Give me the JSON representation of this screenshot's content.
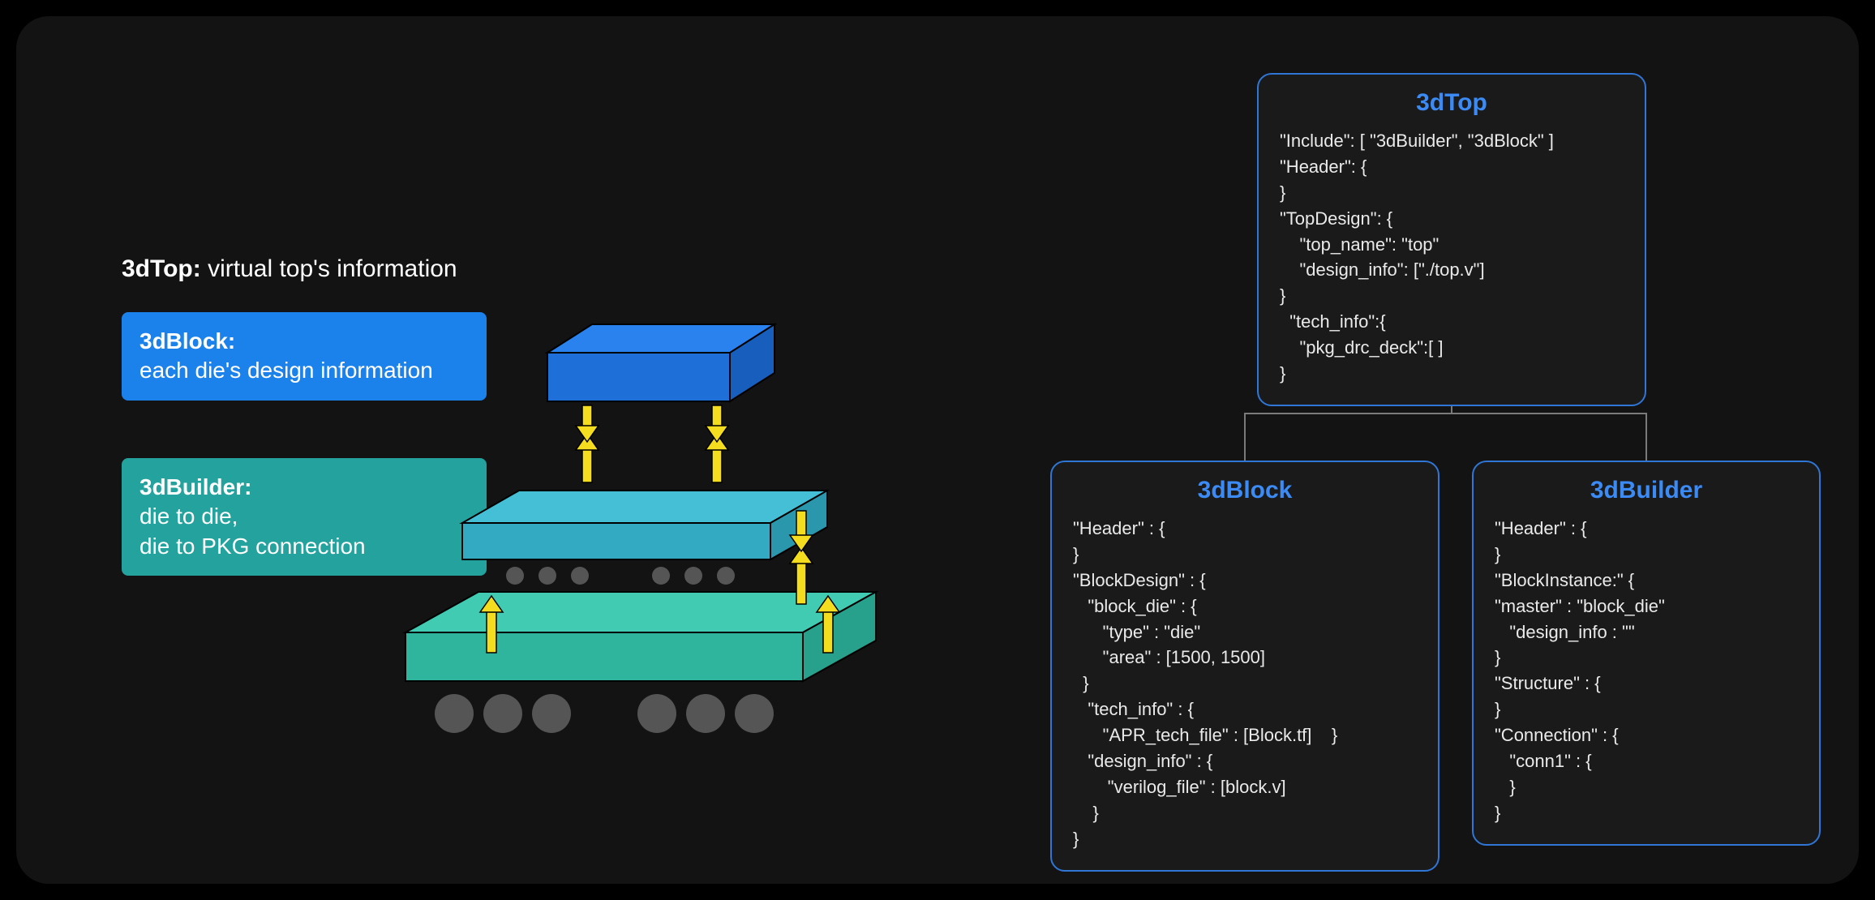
{
  "labels": {
    "top_title": "3dTop:",
    "top_desc": " virtual top's  information",
    "block_title": "3dBlock:",
    "block_desc": "each die's design information",
    "builder_title": "3dBuilder:",
    "builder_desc1": "die to die,",
    "builder_desc2": "die to PKG connection"
  },
  "colors": {
    "accent_blue": "#3c8bf5",
    "box_border": "#2f76d6",
    "block_bg": "#1c82eb",
    "builder_bg": "#24a29d",
    "die_top": "#1b6fe1",
    "die_mid": "#33b4cd",
    "die_bot": "#32c3ab",
    "arrow": "#f4dc1f",
    "ball": "#555"
  },
  "json_boxes": {
    "top": {
      "title": "3dTop",
      "body": "\"Include\": [ \"3dBuilder\", \"3dBlock\" ]\n\"Header\": {\n}\n\"TopDesign\": {\n    \"top_name\": \"top\"\n    \"design_info\": [\"./top.v\"]\n}\n  \"tech_info\":{\n    \"pkg_drc_deck\":[ ]\n}"
    },
    "block": {
      "title": "3dBlock",
      "body": "\"Header\" : {\n}\n\"BlockDesign\" : {\n   \"block_die\" : {\n      \"type\" : \"die\"\n      \"area\" : [1500, 1500]\n  }\n   \"tech_info\" : {\n      \"APR_tech_file\" : [Block.tf]    }\n   \"design_info\" : {\n       \"verilog_file\" : [block.v]\n    }\n}"
    },
    "builder": {
      "title": "3dBuilder",
      "body": "\"Header\" : {\n}\n\"BlockInstance:\" {\n\"master\" : \"block_die\"\n   \"design_info : \"\"\n}\n\"Structure\" : {\n}\n\"Connection\" : {\n   \"conn1\" : {\n   }\n}"
    }
  }
}
